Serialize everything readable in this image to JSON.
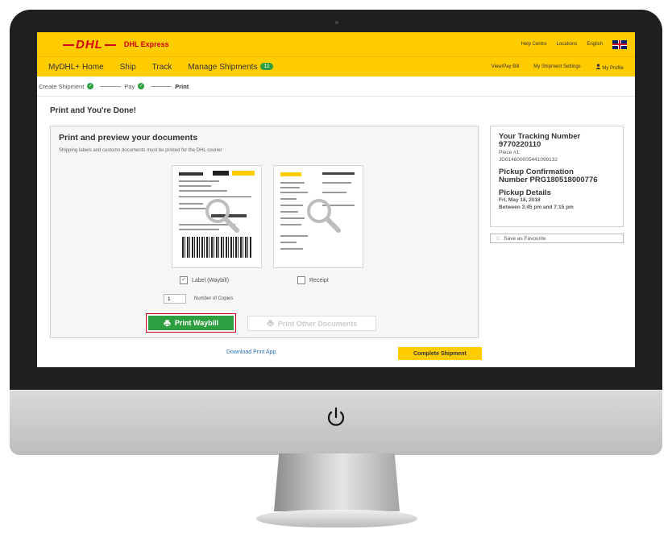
{
  "header": {
    "logo": "DHL",
    "brand": "DHL Express",
    "top_links": [
      "Help Centre",
      "Locations",
      "English"
    ]
  },
  "nav": {
    "items": [
      "MyDHL+ Home",
      "Ship",
      "Track",
      "Manage Shipments"
    ],
    "badge": "11",
    "right_links": [
      "View/Pay Bill",
      "My Shipment Settings",
      "My Profile"
    ]
  },
  "steps": {
    "create": "Create Shipment",
    "pay": "Pay",
    "print": "Print"
  },
  "page": {
    "title": "Print and You're Done!"
  },
  "print_panel": {
    "title": "Print and preview your documents",
    "subtitle": "Shipping labels and customs documents must be printed for the DHL courier",
    "label_option": "Label (Waybill)",
    "receipt_option": "Receipt",
    "copies_value": "1",
    "copies_label": "Number of Copies",
    "print_waybill": "Print Waybill",
    "print_other": "Print Other Documents",
    "download_app": "Download Print App"
  },
  "complete_button": "Complete Shipment",
  "tracking": {
    "title": "Your Tracking Number",
    "number": "9770220110",
    "piece_label": "Piece #1:",
    "piece_number": "JD014600005441099132",
    "pickup_conf_title": "Pickup Confirmation",
    "pickup_conf_number": "Number PRG180518000776",
    "pickup_details_title": "Pickup Details",
    "pickup_date": "Fri, May 18, 2018",
    "pickup_time": "Between 3:45 pm and 7:15 pm"
  },
  "favourite": "Save as Favourite",
  "colors": {
    "dhl_yellow": "#ffcc00",
    "dhl_red": "#d40511",
    "button_green": "#2e9f3f",
    "highlight_red": "#d0021b"
  }
}
